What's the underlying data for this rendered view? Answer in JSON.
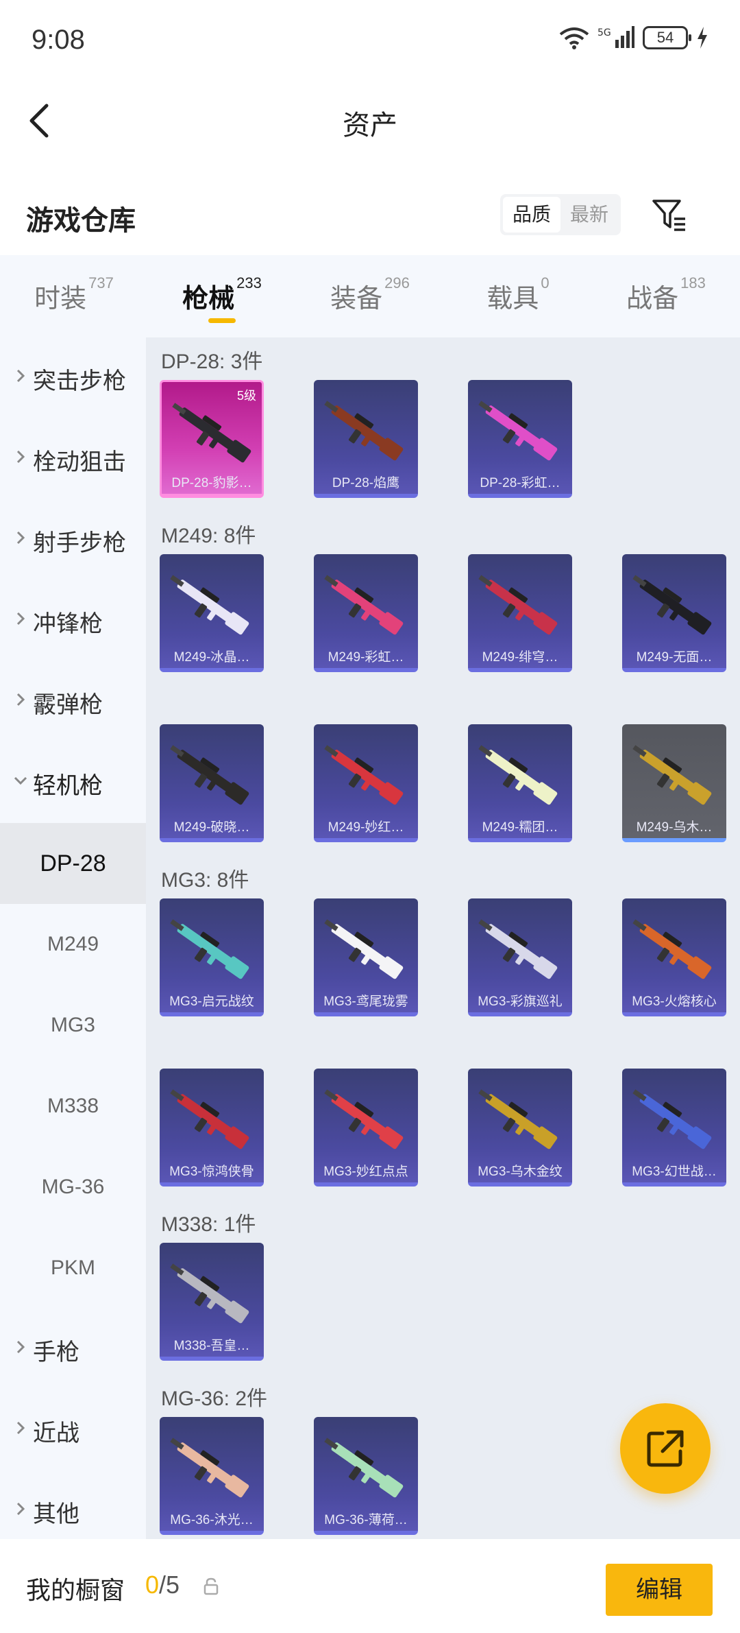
{
  "status": {
    "time": "9:08",
    "battery": "54",
    "network": "5G"
  },
  "header": {
    "title": "资产"
  },
  "warehouse": {
    "title": "游戏仓库",
    "sort": [
      "品质",
      "最新"
    ]
  },
  "tabs": [
    {
      "label": "时装",
      "count": "737"
    },
    {
      "label": "枪械",
      "count": "233"
    },
    {
      "label": "装备",
      "count": "296"
    },
    {
      "label": "载具",
      "count": "0"
    },
    {
      "label": "战备",
      "count": "183"
    }
  ],
  "sidebar": {
    "categories_top": [
      "突击步枪",
      "栓动狙击",
      "射手步枪",
      "冲锋枪",
      "霰弹枪",
      "轻机枪"
    ],
    "subs": [
      "DP-28",
      "M249",
      "MG3",
      "M338",
      "MG-36",
      "PKM"
    ],
    "categories_bottom": [
      "手枪",
      "近战",
      "其他"
    ]
  },
  "groups": [
    {
      "title": "DP-28: 3件",
      "items": [
        {
          "name": "DP-28-豹影…",
          "badge": "5级",
          "style": "legendary",
          "color": "#2b2b30"
        },
        {
          "name": "DP-28-焰鹰",
          "style": "",
          "color": "#8a3a22"
        },
        {
          "name": "DP-28-彩虹…",
          "style": "",
          "color": "#e04fc8"
        }
      ]
    },
    {
      "title": "M249: 8件",
      "items": [
        {
          "name": "M249-冰晶…",
          "style": "",
          "color": "#e8e6f6"
        },
        {
          "name": "M249-彩虹…",
          "style": "",
          "color": "#e3427a"
        },
        {
          "name": "M249-绯穹…",
          "style": "",
          "color": "#c8324a"
        },
        {
          "name": "M249-无面…",
          "style": "",
          "color": "#1f1f24"
        },
        {
          "name": "M249-破晓…",
          "style": "",
          "color": "#2c2a28"
        },
        {
          "name": "M249-妙红…",
          "style": "",
          "color": "#d8363e"
        },
        {
          "name": "M249-糯团…",
          "style": "",
          "color": "#eef2c8"
        },
        {
          "name": "M249-乌木…",
          "style": "gray",
          "color": "#caa12c"
        }
      ]
    },
    {
      "title": "MG3: 8件",
      "items": [
        {
          "name": "MG3-启元战纹",
          "style": "",
          "color": "#58c7c2"
        },
        {
          "name": "MG3-鸢尾珑雾",
          "style": "",
          "color": "#f4f4f6"
        },
        {
          "name": "MG3-彩旗巡礼",
          "style": "",
          "color": "#d8d8ea"
        },
        {
          "name": "MG3-火熔核心",
          "style": "",
          "color": "#d9662a"
        },
        {
          "name": "MG3-惊鸿侠骨",
          "style": "",
          "color": "#c8303a"
        },
        {
          "name": "MG3-妙红点点",
          "style": "",
          "color": "#e04048"
        },
        {
          "name": "MG3-乌木金纹",
          "style": "",
          "color": "#c9a028"
        },
        {
          "name": "MG3-幻世战…",
          "style": "",
          "color": "#4a66d8"
        }
      ]
    },
    {
      "title": "M338: 1件",
      "items": [
        {
          "name": "M338-吾皇…",
          "style": "",
          "color": "#b8b8c0"
        }
      ]
    },
    {
      "title": "MG-36: 2件",
      "items": [
        {
          "name": "MG-36-沐光…",
          "style": "",
          "color": "#e8b8a0"
        },
        {
          "name": "MG-36-薄荷…",
          "style": "",
          "color": "#a8e0b8"
        }
      ]
    }
  ],
  "bottom": {
    "showcase_label": "我的橱窗",
    "current": "0",
    "total": "/5",
    "edit": "编辑"
  }
}
